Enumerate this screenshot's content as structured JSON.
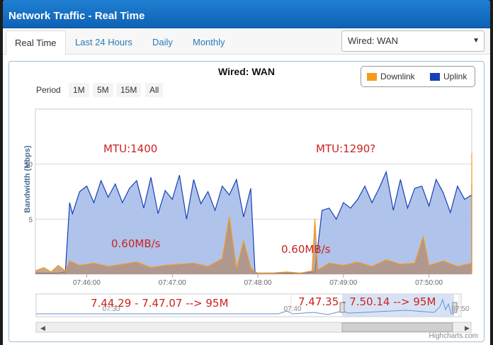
{
  "window": {
    "title": "Network Traffic - Real Time"
  },
  "tabs": [
    {
      "label": "Real Time",
      "active": true
    },
    {
      "label": "Last 24 Hours",
      "active": false
    },
    {
      "label": "Daily",
      "active": false
    },
    {
      "label": "Monthly",
      "active": false
    }
  ],
  "interface_select": {
    "value": "Wired: WAN"
  },
  "period": {
    "label": "Period",
    "buttons": [
      "1M",
      "5M",
      "15M",
      "All"
    ]
  },
  "credit": "Highcharts.com",
  "colors": {
    "downlink": "#f89a1c",
    "uplink": "#1640b8",
    "uplink_fill": "#a7bde8",
    "accent": "#1a72c6"
  },
  "chart_data": {
    "type": "area",
    "title": "Wired: WAN",
    "ylabel": "Bandwidth (Mbps)",
    "ylim": [
      0,
      15
    ],
    "yticks": [
      5,
      10
    ],
    "xlim": [
      "07:45:24",
      "07:50:30"
    ],
    "xticks": [
      "07:46:00",
      "07:47:00",
      "07:48:00",
      "07:49:00",
      "07:50:00"
    ],
    "legend": {
      "position": "top-right",
      "items": [
        "Downlink",
        "Uplink"
      ]
    },
    "series": [
      {
        "name": "Uplink",
        "x_seconds_from_0745": [
          24,
          30,
          40,
          45,
          48,
          50,
          55,
          60,
          65,
          70,
          75,
          80,
          85,
          90,
          95,
          100,
          105,
          110,
          115,
          120,
          125,
          130,
          135,
          140,
          145,
          150,
          155,
          160,
          165,
          170,
          175,
          178,
          180,
          190,
          200,
          210,
          220,
          225,
          230,
          235,
          240,
          245,
          250,
          255,
          260,
          265,
          270,
          275,
          280,
          285,
          290,
          295,
          300,
          305,
          310,
          315,
          320,
          325,
          330,
          335,
          340,
          345,
          350,
          355,
          360,
          365,
          370,
          375,
          380,
          385,
          390,
          395,
          400,
          405,
          410,
          415,
          420,
          425,
          430,
          435,
          440,
          445,
          450,
          455,
          460,
          465,
          470,
          475,
          480,
          485,
          490,
          495,
          500,
          505,
          510,
          515,
          520,
          525,
          530,
          535,
          540,
          545,
          550,
          555,
          560,
          565,
          570,
          575,
          580,
          585,
          590,
          595,
          600,
          605,
          610,
          615,
          620,
          630
        ],
        "values": [
          0.1,
          0.1,
          0.1,
          0.2,
          6.5,
          5.5,
          7.5,
          8.0,
          6.5,
          8.5,
          7.0,
          8.2,
          6.5,
          7.8,
          8.5,
          6.0,
          8.8,
          5.5,
          7.6,
          6.8,
          9.0,
          5.0,
          8.6,
          6.4,
          7.5,
          5.8,
          8.0,
          7.2,
          8.6,
          5.2,
          7.8,
          0.2,
          0.1,
          0.1,
          0.1,
          0.1,
          0.2,
          5.8,
          6.0,
          5.0,
          6.5,
          6.0,
          6.8,
          8.0,
          6.5,
          7.8,
          9.3,
          5.8,
          8.6,
          6.0,
          7.8,
          8.0,
          6.2,
          8.6,
          7.4,
          5.6,
          8.0,
          6.8,
          7.2,
          6.0,
          8.2,
          5.4,
          6.6,
          5.0,
          5.8,
          6.2,
          5.4,
          5.0,
          7.2,
          5.6,
          6.8,
          5.8,
          6.6,
          7.6,
          5.4,
          6.8,
          5.8,
          7.5,
          6.2,
          6.4,
          5.2,
          7.0,
          5.8,
          6.2,
          7.0,
          5.6,
          7.2,
          5.4,
          6.6,
          6.0,
          7.8,
          5.2,
          6.8,
          7.0,
          5.4,
          6.6,
          6.0,
          7.6,
          5.4,
          6.8,
          4.6,
          6.6,
          5.2,
          6.0,
          5.0,
          6.8,
          4.8,
          6.4,
          5.6,
          6.0,
          5.8,
          6.6,
          5.2,
          6.2,
          5.0,
          6.8,
          0.2,
          0.1
        ]
      },
      {
        "name": "Downlink",
        "x_seconds_from_0745": [
          24,
          30,
          35,
          40,
          45,
          48,
          55,
          65,
          75,
          85,
          95,
          105,
          115,
          125,
          135,
          145,
          155,
          160,
          165,
          170,
          175,
          178,
          180,
          190,
          200,
          210,
          218,
          220,
          222,
          225,
          230,
          240,
          250,
          260,
          270,
          280,
          290,
          296,
          300,
          310,
          320,
          330,
          340,
          350,
          360,
          370,
          380,
          390,
          400,
          410,
          420,
          430,
          440,
          450,
          460,
          470,
          480,
          490,
          500,
          510,
          515,
          520,
          525,
          530,
          535,
          540,
          545,
          550,
          555,
          560,
          565,
          570,
          575,
          580,
          585,
          590,
          595,
          600,
          605,
          610,
          615,
          620,
          630
        ],
        "values": [
          0.3,
          0.6,
          0.2,
          0.8,
          0.3,
          1.2,
          0.8,
          1.0,
          0.7,
          0.9,
          1.1,
          0.6,
          0.8,
          0.9,
          1.0,
          0.7,
          1.4,
          5.2,
          0.5,
          3.0,
          0.6,
          0.2,
          0.1,
          0.1,
          0.2,
          0.1,
          0.3,
          5.0,
          0.4,
          0.6,
          1.0,
          0.8,
          1.1,
          0.7,
          1.3,
          0.9,
          1.0,
          3.4,
          0.8,
          1.2,
          0.7,
          1.0,
          0.8,
          1.1,
          0.9,
          3.0,
          0.8,
          1.0,
          0.7,
          1.2,
          0.9,
          1.0,
          0.8,
          1.1,
          0.7,
          1.0,
          0.9,
          1.0,
          1.1,
          6.0,
          0.8,
          11.0,
          0.6,
          9.0,
          1.4,
          7.2,
          4.0,
          10.8,
          1.2,
          6.6,
          2.0,
          9.8,
          4.0,
          6.4,
          1.6,
          7.4,
          1.2,
          4.0,
          0.8,
          0.6,
          0.4,
          0.2,
          0.1
        ]
      }
    ],
    "navigator": {
      "xticks": [
        "07:30",
        "07:40",
        "07:50"
      ],
      "selected_range": [
        "07:45:24",
        "07:50:30"
      ]
    }
  },
  "annotations": {
    "mtu1": "MTU:1400",
    "mtu2": "MTU:1290?",
    "rate1": "0.60MB/s",
    "rate2": "0.60MB/s",
    "range1": "7.44.29 - 7.47.07 --> 95M",
    "range2": "7.47.35 - 7.50.14 --> 95M"
  }
}
